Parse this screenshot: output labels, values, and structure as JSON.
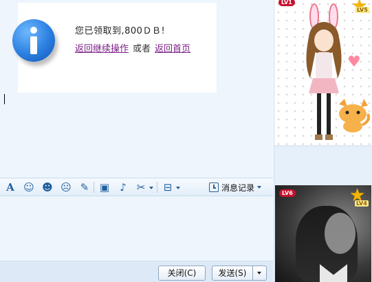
{
  "notice": {
    "message": "您已领取到,800ＤＢ!",
    "link_continue": "返回继续操作",
    "or_text": "或者",
    "link_home": "返回首页"
  },
  "toolbar": {
    "icons": [
      "font-icon",
      "emoji-icon",
      "avatar-face-icon",
      "cartoon-icon",
      "edit-icon",
      "image-icon",
      "music-icon",
      "screenshot-scissors-icon",
      "briefcase-icon"
    ],
    "history_label": "消息记录"
  },
  "buttons": {
    "close_label": "关闭(C)",
    "send_label": "发送(S)"
  },
  "avatar_panel": {
    "level_top": "LV1",
    "star_level": "LV5"
  },
  "photo_panel": {
    "level_badge": "LV6",
    "star_level": "LV4"
  },
  "colors": {
    "link": "#7b1f87",
    "toolbar_icon": "#1f5f9e",
    "badge_red": "#c8102e",
    "star_gold": "#f5b400"
  }
}
